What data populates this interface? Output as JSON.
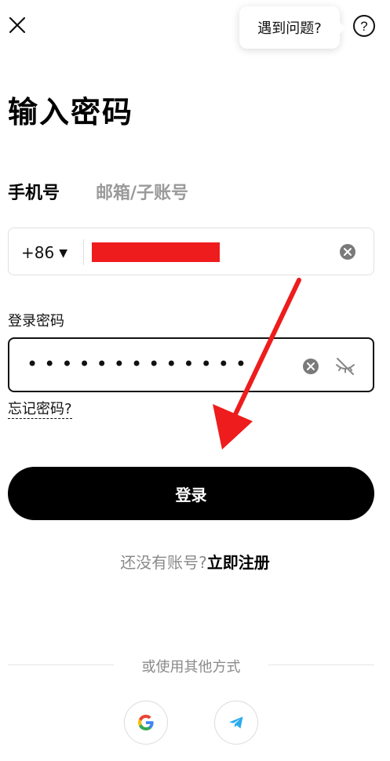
{
  "help": {
    "bubble_text": "遇到问题?"
  },
  "page": {
    "title": "输入密码"
  },
  "tabs": [
    {
      "label": "手机号",
      "active": true
    },
    {
      "label": "邮箱/子账号",
      "active": false
    }
  ],
  "phone": {
    "country_code": "+86"
  },
  "password": {
    "label": "登录密码",
    "masked_value": "•••••••••••••",
    "forgot_label": "忘记密码?"
  },
  "actions": {
    "login_label": "登录"
  },
  "register": {
    "prompt": "还没有账号?",
    "link": "立即注册"
  },
  "other_login": {
    "label": "或使用其他方式"
  },
  "colors": {
    "redaction": "#ee1c1c",
    "annotation_arrow": "#ee1c1c",
    "primary_button": "#000000"
  },
  "icons": {
    "close": "close-icon",
    "help": "help-icon",
    "clear": "clear-icon",
    "eye_off": "eye-off-icon",
    "google": "google-icon",
    "telegram": "telegram-icon"
  }
}
